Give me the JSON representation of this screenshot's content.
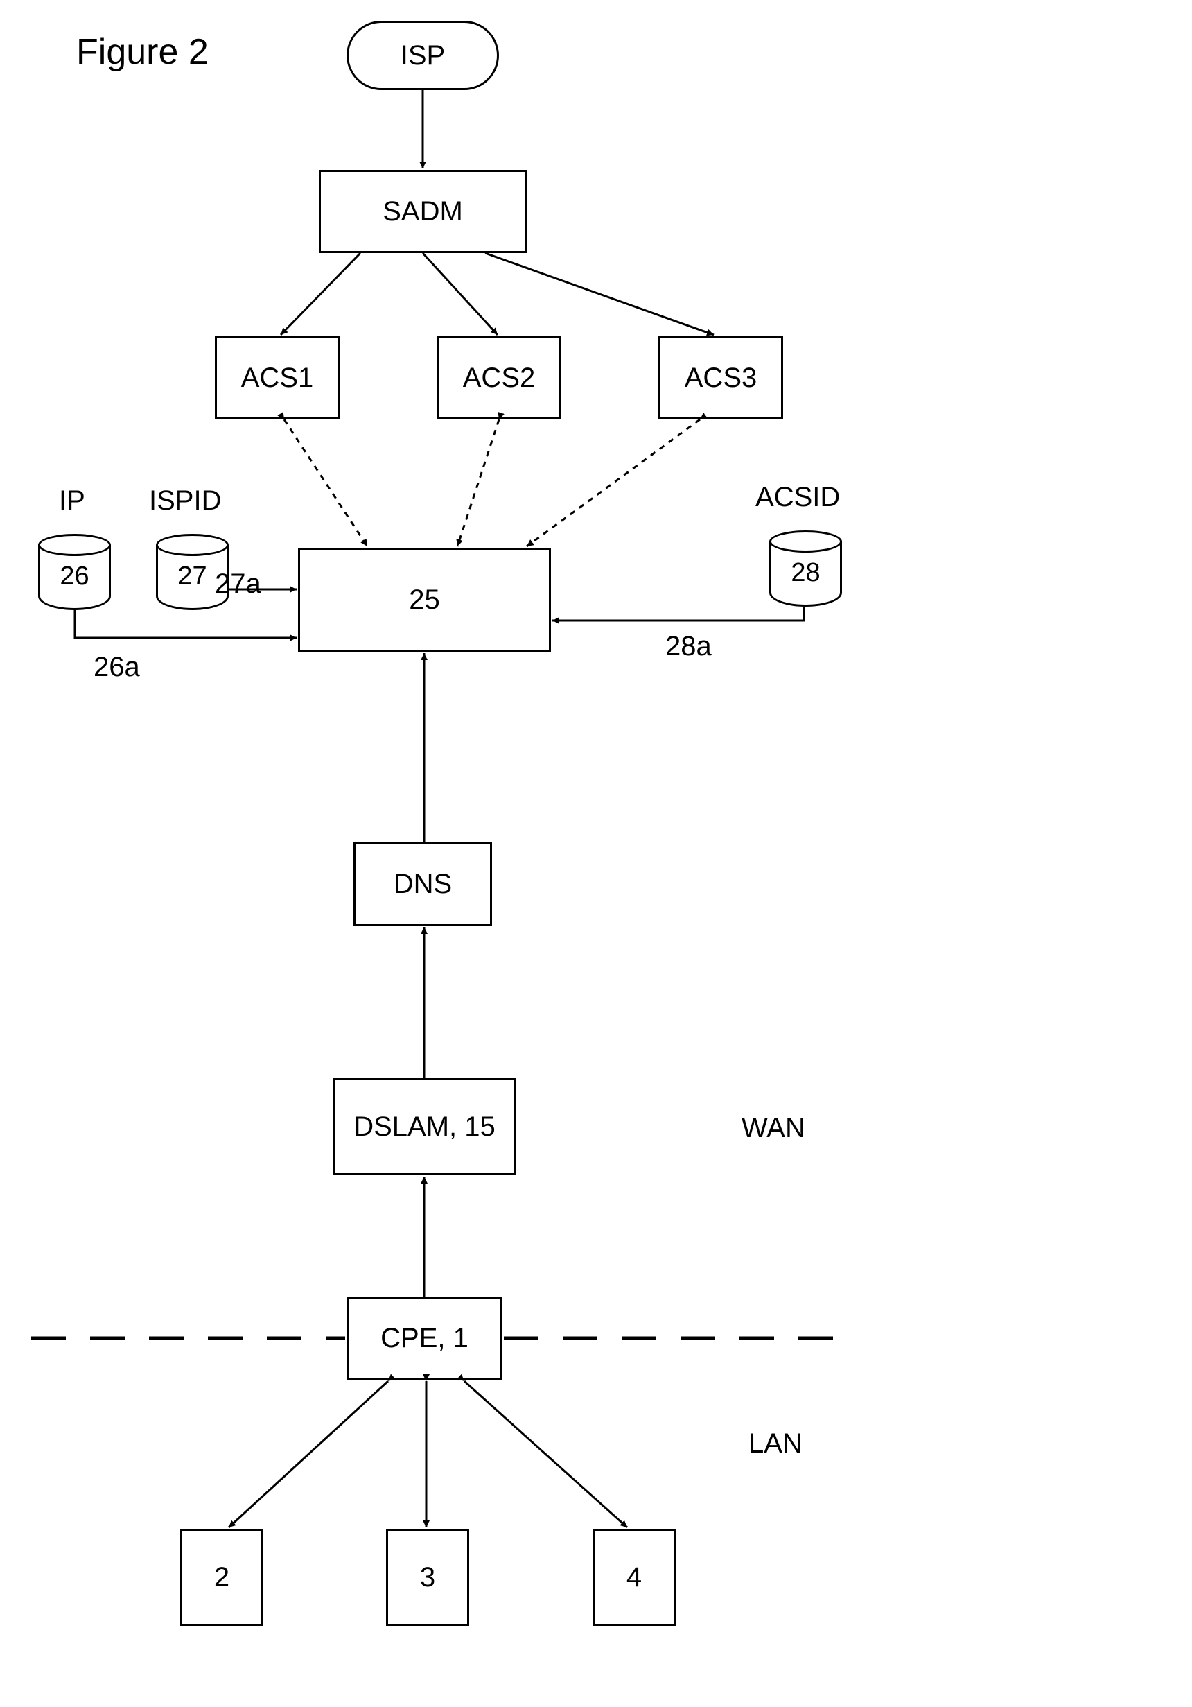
{
  "figureTitle": "Figure 2",
  "nodes": {
    "isp": "ISP",
    "sadm": "SADM",
    "acs1": "ACS1",
    "acs2": "ACS2",
    "acs3": "ACS3",
    "n25": "25",
    "dns": "DNS",
    "dslam": "DSLAM, 15",
    "cpe": "CPE, 1",
    "n2": "2",
    "n3": "3",
    "n4": "4"
  },
  "cylinders": {
    "ip": {
      "topLabel": "IP",
      "num": "26"
    },
    "ispid": {
      "topLabel": "ISPID",
      "num": "27"
    },
    "acsid": {
      "topLabel": "ACSID",
      "num": "28"
    }
  },
  "textLabels": {
    "l26a": "26a",
    "l27a": "27a",
    "l28a": "28a",
    "wan": "WAN",
    "lan": "LAN"
  }
}
